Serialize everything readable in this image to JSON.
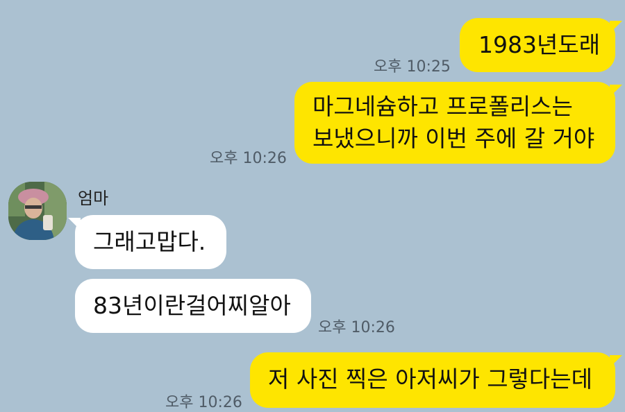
{
  "chat": {
    "messages": [
      {
        "text": "1983년도래",
        "time": "오후 10:25"
      },
      {
        "line1": "마그네슘하고 프로폴리스는",
        "line2": "보냈으니까 이번 주에 갈 거야",
        "time": "오후 10:26"
      },
      {
        "sender": "엄마",
        "text": "그래고맙다."
      },
      {
        "text": "83년이란걸어찌알아",
        "time": "오후 10:26"
      },
      {
        "text": "저 사진 찍은 아저씨가 그렇다는데",
        "time": "오후 10:26"
      }
    ]
  },
  "colors": {
    "background": "#abc1d1",
    "my_bubble": "#fee500",
    "their_bubble": "#ffffff"
  },
  "icons": {
    "avatar": "profile-photo"
  }
}
